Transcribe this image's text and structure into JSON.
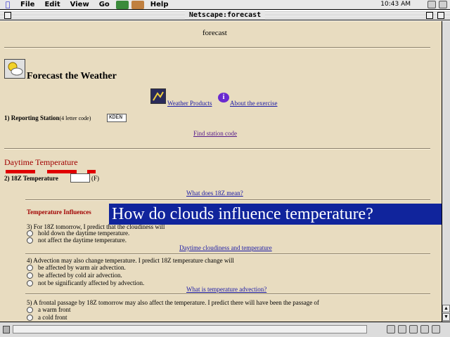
{
  "menubar": {
    "items": [
      "File",
      "Edit",
      "View",
      "Go",
      "Help"
    ],
    "clock": "10:43 AM"
  },
  "window": {
    "title": "Netscape:forecast"
  },
  "page": {
    "heading": "forecast",
    "title": "Forecast the Weather",
    "links": {
      "weather_products": "Weather Products",
      "about_exercise": "About the exercise",
      "find_station": "Find station code",
      "what_does_18z": "What does 18Z mean?",
      "daytime_cloudiness": "Daytime cloudiness and temperature",
      "temp_advection": "What is temperature advection?"
    },
    "reporting_station": {
      "label": "1) Reporting Station",
      "hint": "(4 letter code)",
      "value": "KDEN"
    },
    "daytime_section": {
      "heading": "Daytime Temperature",
      "temp_label": "2) 18Z Temperature",
      "temp_unit": "(F)"
    },
    "influences": {
      "heading": "Temperature Influences",
      "q3": "3) For 18Z tomorrow, I predict that the cloudiness will",
      "q3_options": [
        "hold down the daytime temperature.",
        "not affect the daytime temperature."
      ],
      "q4": "4) Advection may also change temperature. I predict 18Z temperature change will",
      "q4_options": [
        "be affected by warm air advection.",
        "be affected by cold air advection.",
        "not be significantly affected by advection."
      ],
      "q5": "5) A frontal passage by 18Z tomorrow may also affect the temperature. I predict there will have been the passage of",
      "q5_options": [
        "a warm front",
        "a cold front"
      ]
    }
  },
  "overlay_caption": "How do clouds influence temperature?",
  "colors": {
    "page_background": "#e8dcc0",
    "caption_background": "#10249c",
    "caption_text": "#ffffff",
    "section_heading": "#a00000"
  }
}
